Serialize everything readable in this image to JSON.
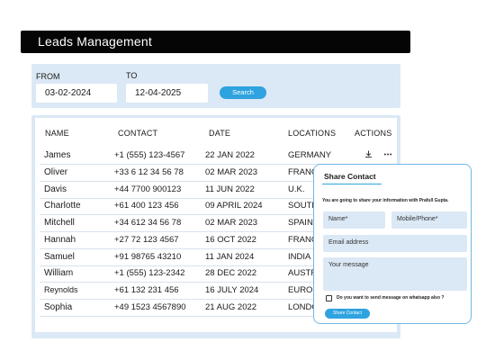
{
  "header": {
    "title": "Leads Management"
  },
  "filters": {
    "from_label": "FROM",
    "from_value": "03-02-2024",
    "to_label": "TO",
    "to_value": "12-04-2025",
    "search_label": "Search"
  },
  "table": {
    "columns": [
      "NAME",
      "CONTACT",
      "DATE",
      "LOCATIONS",
      "ACTIONS"
    ],
    "rows": [
      {
        "name": "James",
        "contact": "+1 (555) 123-4567",
        "date": "22 JAN 2022",
        "location": "GERMANY"
      },
      {
        "name": "Oliver",
        "contact": "+33 6 12 34 56 78",
        "date": "02 MAR 2023",
        "location": "FRANC"
      },
      {
        "name": "Davis",
        "contact": "+44 7700 900123",
        "date": "11 JUN 2022",
        "location": "U.K."
      },
      {
        "name": "Charlotte",
        "contact": "+61 400 123 456",
        "date": "09 APRIL 2024",
        "location": "SOUTH"
      },
      {
        "name": "Mitchell",
        "contact": "+34 612 34 56 78",
        "date": "02 MAR 2023",
        "location": "SPAIN"
      },
      {
        "name": "Hannah",
        "contact": "+27 72 123 4567",
        "date": "16 OCT 2022",
        "location": "FRANC"
      },
      {
        "name": "Samuel",
        "contact": "+91 98765 43210",
        "date": "11 JAN 2024",
        "location": "INDIA"
      },
      {
        "name": "William",
        "contact": "+1 (555) 123-2342",
        "date": "28 DEC 2022",
        "location": "AUSTR"
      },
      {
        "name": "Reynolds",
        "contact": "+61 132 231 456",
        "date": "16 JULY 2024",
        "location": "EUROP"
      },
      {
        "name": "Sophia",
        "contact": "+49 1523 4567890",
        "date": "21 AUG 2022",
        "location": "LONDO"
      }
    ],
    "action_icons": [
      "download-icon",
      "more-icon"
    ]
  },
  "dialog": {
    "title": "Share Contact",
    "description": "You are going to share your information with Prafull Gupta.",
    "name_placeholder": "Name*",
    "phone_placeholder": "Mobile/Phone*",
    "email_placeholder": "Email address",
    "message_placeholder": "Your message",
    "whatsapp_label": "Do you want to send message on whatsapp also ?",
    "submit_label": "Share Contact"
  },
  "colors": {
    "accent": "#2ea3e0",
    "panel": "#dbe8f5",
    "title_bar": "#050505"
  }
}
